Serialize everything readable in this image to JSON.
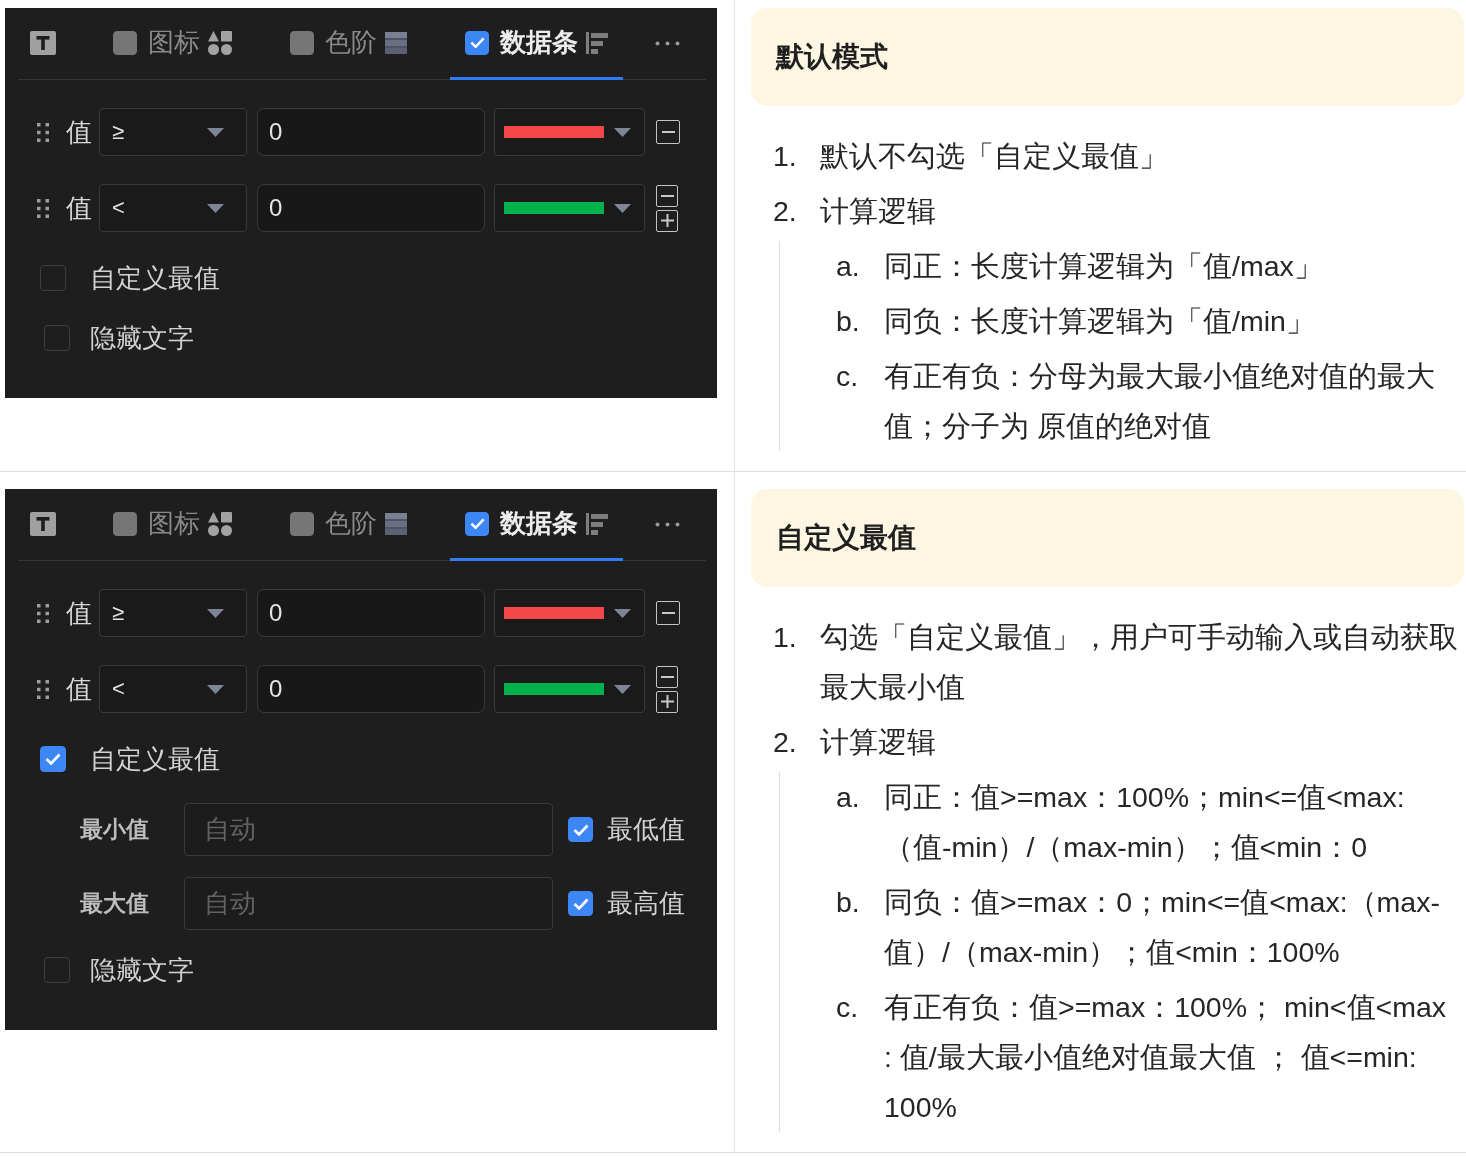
{
  "rows": [
    {
      "panel": {
        "tabs": [
          {
            "kind": "icon",
            "selected": false
          },
          {
            "kind": "checkbox",
            "label": "图标",
            "checked": false,
            "selected": false
          },
          {
            "kind": "checkbox",
            "label": "色阶",
            "checked": false,
            "selected": false
          },
          {
            "kind": "checkbox",
            "label": "数据条",
            "checked": true,
            "selected": true
          }
        ],
        "rules": [
          {
            "label": "值",
            "operator": "≥",
            "value": "0",
            "color": "#f5464a",
            "can_add": false
          },
          {
            "label": "值",
            "operator": "<",
            "value": "0",
            "color": "#00b24c",
            "can_add": true
          }
        ],
        "custom_range": {
          "label": "自定义最值",
          "checked": false
        },
        "hide_text": {
          "label": "隐藏文字",
          "checked": false
        }
      },
      "notes": {
        "heading": "默认模式",
        "items": [
          {
            "marker": "1.",
            "text": "默认不勾选「自定义最值」"
          },
          {
            "marker": "2.",
            "text": "计算逻辑",
            "children": [
              {
                "marker": "a.",
                "text": "同正：长度计算逻辑为「值/max」"
              },
              {
                "marker": "b.",
                "text": "同负：长度计算逻辑为「值/min」"
              },
              {
                "marker": "c.",
                "text": "有正有负：分母为最大最小值绝对值的最大值；分子为 原值的绝对值"
              }
            ]
          }
        ]
      }
    },
    {
      "panel": {
        "tabs": [
          {
            "kind": "icon",
            "selected": false
          },
          {
            "kind": "checkbox",
            "label": "图标",
            "checked": false,
            "selected": false
          },
          {
            "kind": "checkbox",
            "label": "色阶",
            "checked": false,
            "selected": false
          },
          {
            "kind": "checkbox",
            "label": "数据条",
            "checked": true,
            "selected": true
          }
        ],
        "rules": [
          {
            "label": "值",
            "operator": "≥",
            "value": "0",
            "color": "#f5464a",
            "can_add": false
          },
          {
            "label": "值",
            "operator": "<",
            "value": "0",
            "color": "#00b24c",
            "can_add": true
          }
        ],
        "custom_range": {
          "label": "自定义最值",
          "checked": true,
          "fields": [
            {
              "label": "最小值",
              "placeholder": "自动",
              "option": {
                "label": "最低值",
                "checked": true
              }
            },
            {
              "label": "最大值",
              "placeholder": "自动",
              "option": {
                "label": "最高值",
                "checked": true
              }
            }
          ]
        },
        "hide_text": {
          "label": "隐藏文字",
          "checked": false
        }
      },
      "notes": {
        "heading": "自定义最值",
        "items": [
          {
            "marker": "1.",
            "text": "勾选「自定义最值」，用户可手动输入或自动获取最大最小值"
          },
          {
            "marker": "2.",
            "text": "计算逻辑",
            "children": [
              {
                "marker": "a.",
                "text": "同正：值>=max：100%；min<=值<max:（值-min）/（max-min）；值<min：0"
              },
              {
                "marker": "b.",
                "text": "同负：值>=max：0；min<=值<max:（max-值）/（max-min）；值<min：100%"
              },
              {
                "marker": "c.",
                "text": "有正有负：值>=max：100%； min<值<max : 值/最大最小值绝对值最大值 ； 值<=min: 100%"
              }
            ]
          }
        ]
      }
    }
  ]
}
